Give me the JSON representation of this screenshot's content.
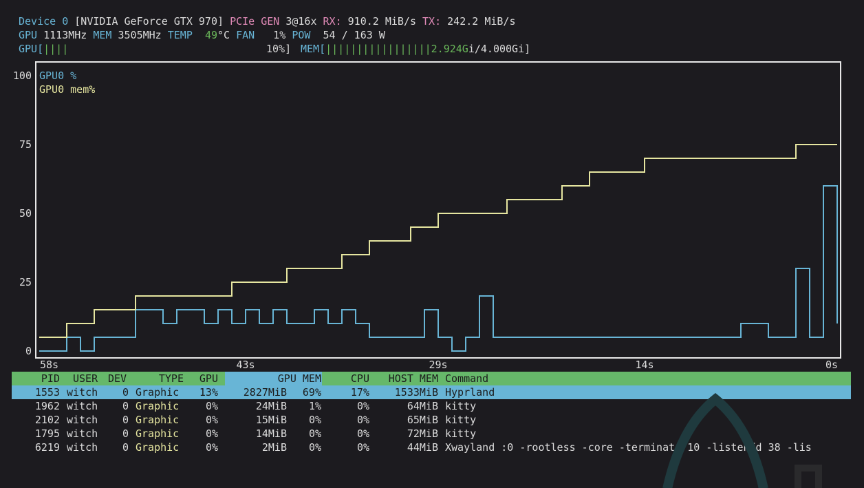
{
  "device": {
    "label": "Device 0",
    "name": "[NVIDIA GeForce GTX 970]",
    "pcie_label": "PCIe GEN",
    "pcie_value": "3@16x",
    "rx_label": "RX:",
    "rx_value": "910.2 MiB/s",
    "tx_label": "TX:",
    "tx_value": "242.2 MiB/s"
  },
  "stats": {
    "gpu_label": "GPU",
    "gpu_clock": "1113MHz",
    "mem_label": "MEM",
    "mem_clock": "3505MHz",
    "temp_label": "TEMP",
    "temp_value": "49",
    "temp_unit": "°C",
    "fan_label": "FAN",
    "fan_value": "1%",
    "pow_label": "POW",
    "pow_value": "54 / 163 W"
  },
  "bars": {
    "gpu_label": "GPU[",
    "gpu_fill": "||||",
    "gpu_percent": "10%]",
    "gpu_fraction": 0.1,
    "mem_label": "MEM[",
    "mem_fill": "|||||||||||||||||",
    "mem_used": "2.924G",
    "mem_total": "i/4.000Gi]",
    "mem_fraction": 0.731
  },
  "chart_data": {
    "type": "line",
    "legend": [
      "GPU0 %",
      "GPU0 mem%"
    ],
    "y_ticks": [
      "100",
      "75",
      "50",
      "25",
      "0"
    ],
    "ylim": [
      0,
      100
    ],
    "x_ticks": [
      "58s",
      "43s",
      "29s",
      "14s",
      "0s"
    ],
    "x_seconds_ago": [
      58,
      43,
      29,
      14,
      0
    ],
    "series": [
      {
        "name": "GPU0 %",
        "color": "#68b5d6",
        "t": [
          58,
          57,
          56,
          55,
          54,
          53,
          52,
          51,
          50,
          49,
          48,
          47,
          46,
          45,
          44,
          43,
          42,
          41,
          40,
          39,
          38,
          37,
          36,
          35,
          34,
          33,
          32,
          31,
          30,
          29,
          28,
          27,
          26,
          25,
          24,
          23,
          22,
          21,
          20,
          19,
          18,
          17,
          16,
          15,
          14,
          13,
          12,
          11,
          10,
          9,
          8,
          7,
          6,
          5,
          4,
          3,
          2,
          1,
          0
        ],
        "values": [
          0,
          0,
          5,
          0,
          5,
          5,
          5,
          15,
          15,
          10,
          15,
          15,
          10,
          15,
          10,
          15,
          10,
          15,
          10,
          10,
          15,
          10,
          15,
          10,
          5,
          5,
          5,
          5,
          15,
          5,
          0,
          5,
          20,
          5,
          5,
          5,
          5,
          5,
          5,
          5,
          5,
          5,
          5,
          5,
          5,
          5,
          5,
          5,
          5,
          5,
          5,
          10,
          10,
          5,
          5,
          30,
          5,
          60,
          10
        ]
      },
      {
        "name": "GPU0 mem%",
        "color": "#e6e6a0",
        "t": [
          58,
          57,
          56,
          55,
          54,
          53,
          52,
          51,
          50,
          49,
          48,
          47,
          46,
          45,
          44,
          43,
          42,
          41,
          40,
          39,
          38,
          37,
          36,
          35,
          34,
          33,
          32,
          31,
          30,
          29,
          28,
          27,
          26,
          25,
          24,
          23,
          22,
          21,
          20,
          19,
          18,
          17,
          16,
          15,
          14,
          13,
          12,
          11,
          10,
          9,
          8,
          7,
          6,
          5,
          4,
          3,
          2,
          1,
          0
        ],
        "values": [
          5,
          5,
          10,
          10,
          15,
          15,
          15,
          20,
          20,
          20,
          20,
          20,
          20,
          20,
          25,
          25,
          25,
          25,
          30,
          30,
          30,
          30,
          35,
          35,
          40,
          40,
          40,
          45,
          45,
          50,
          50,
          50,
          50,
          50,
          55,
          55,
          55,
          55,
          60,
          60,
          65,
          65,
          65,
          65,
          70,
          70,
          70,
          70,
          70,
          70,
          70,
          70,
          70,
          70,
          70,
          75,
          75,
          75,
          75
        ]
      }
    ]
  },
  "process_table": {
    "headers": {
      "pid": "PID",
      "user": "USER",
      "dev": "DEV",
      "type": "TYPE",
      "gpu": "GPU",
      "gpu_mem": "GPU MEM",
      "cpu": "CPU",
      "host_mem": "HOST MEM",
      "command": "Command"
    },
    "rows": [
      {
        "pid": "1553",
        "user": "witch",
        "dev": "0",
        "type": "Graphic",
        "gpu": "13%",
        "gpu_mem": "2827MiB",
        "gpu_mem_pct": "69%",
        "cpu": "17%",
        "host_mem": "1533MiB",
        "command": "Hyprland"
      },
      {
        "pid": "1962",
        "user": "witch",
        "dev": "0",
        "type": "Graphic",
        "gpu": "0%",
        "gpu_mem": "24MiB",
        "gpu_mem_pct": "1%",
        "cpu": "0%",
        "host_mem": "64MiB",
        "command": "kitty"
      },
      {
        "pid": "2102",
        "user": "witch",
        "dev": "0",
        "type": "Graphic",
        "gpu": "0%",
        "gpu_mem": "15MiB",
        "gpu_mem_pct": "0%",
        "cpu": "0%",
        "host_mem": "65MiB",
        "command": "kitty"
      },
      {
        "pid": "1795",
        "user": "witch",
        "dev": "0",
        "type": "Graphic",
        "gpu": "0%",
        "gpu_mem": "14MiB",
        "gpu_mem_pct": "0%",
        "cpu": "0%",
        "host_mem": "72MiB",
        "command": "kitty"
      },
      {
        "pid": "6219",
        "user": "witch",
        "dev": "0",
        "type": "Graphic",
        "gpu": "0%",
        "gpu_mem": "2MiB",
        "gpu_mem_pct": "0%",
        "cpu": "0%",
        "host_mem": "44MiB",
        "command": "Xwayland :0 -rootless -core -terminate 10 -listenfd 38 -lis"
      }
    ]
  }
}
